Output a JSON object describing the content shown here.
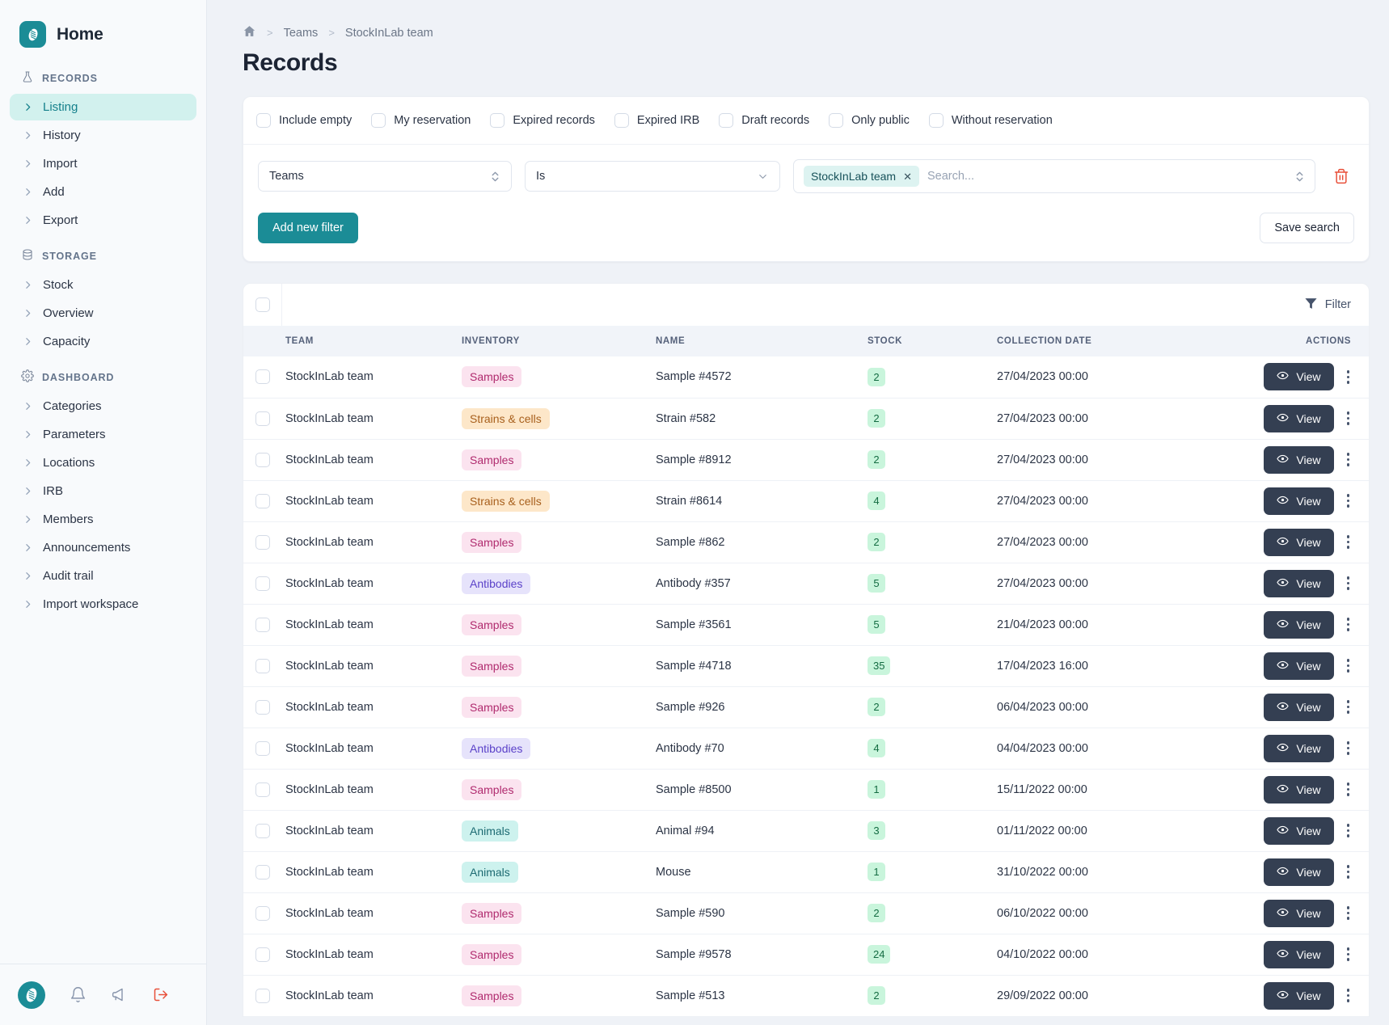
{
  "sidebar": {
    "brand": {
      "title": "Home",
      "logo_icon": "dna-logo-icon"
    },
    "sections": [
      {
        "title": "RECORDS",
        "icon": "flask-icon",
        "items": [
          {
            "label": "Listing",
            "active": true
          },
          {
            "label": "History",
            "active": false
          },
          {
            "label": "Import",
            "active": false
          },
          {
            "label": "Add",
            "active": false
          },
          {
            "label": "Export",
            "active": false
          }
        ]
      },
      {
        "title": "STORAGE",
        "icon": "database-icon",
        "items": [
          {
            "label": "Stock",
            "active": false
          },
          {
            "label": "Overview",
            "active": false
          },
          {
            "label": "Capacity",
            "active": false
          }
        ]
      },
      {
        "title": "DASHBOARD",
        "icon": "gear-icon",
        "items": [
          {
            "label": "Categories",
            "active": false
          },
          {
            "label": "Parameters",
            "active": false
          },
          {
            "label": "Locations",
            "active": false
          },
          {
            "label": "IRB",
            "active": false
          },
          {
            "label": "Members",
            "active": false
          },
          {
            "label": "Announcements",
            "active": false
          },
          {
            "label": "Audit trail",
            "active": false
          },
          {
            "label": "Import workspace",
            "active": false
          }
        ]
      }
    ],
    "footer_icons": [
      {
        "name": "app-logo-icon"
      },
      {
        "name": "bell-icon"
      },
      {
        "name": "megaphone-icon"
      },
      {
        "name": "logout-icon"
      }
    ]
  },
  "breadcrumb": {
    "home_icon": "home-icon",
    "items": [
      "Teams",
      "StockInLab team"
    ],
    "separator": ">"
  },
  "page": {
    "title": "Records"
  },
  "filters": {
    "checkboxes": [
      {
        "label": "Include empty",
        "checked": false
      },
      {
        "label": "My reservation",
        "checked": false
      },
      {
        "label": "Expired records",
        "checked": false
      },
      {
        "label": "Expired IRB",
        "checked": false
      },
      {
        "label": "Draft records",
        "checked": false
      },
      {
        "label": "Only public",
        "checked": false
      },
      {
        "label": "Without reservation",
        "checked": false
      }
    ],
    "field_select": {
      "value": "Teams",
      "icon": "chevron-updown-icon"
    },
    "operator_select": {
      "value": "Is",
      "icon": "chevron-down-icon"
    },
    "value_field": {
      "chips": [
        "StockInLab team"
      ],
      "chip_remove_icon": "close-icon",
      "placeholder": "Search...",
      "icon": "chevron-updown-icon"
    },
    "delete_icon": "trash-icon",
    "add_filter_label": "Add new filter",
    "save_search_label": "Save search"
  },
  "table": {
    "filter_button": {
      "label": "Filter",
      "icon": "funnel-icon"
    },
    "select_all_checkbox": false,
    "columns": [
      "TEAM",
      "INVENTORY",
      "NAME",
      "STOCK",
      "COLLECTION DATE",
      "ACTIONS"
    ],
    "row_action": {
      "label": "View",
      "icon": "eye-icon",
      "menu_icon": "kebab-icon"
    },
    "rows": [
      {
        "team": "StockInLab team",
        "inventory": "Samples",
        "type": "samples",
        "name": "Sample #4572",
        "stock": "2",
        "date": "27/04/2023 00:00"
      },
      {
        "team": "StockInLab team",
        "inventory": "Strains & cells",
        "type": "strains",
        "name": "Strain #582",
        "stock": "2",
        "date": "27/04/2023 00:00"
      },
      {
        "team": "StockInLab team",
        "inventory": "Samples",
        "type": "samples",
        "name": "Sample #8912",
        "stock": "2",
        "date": "27/04/2023 00:00"
      },
      {
        "team": "StockInLab team",
        "inventory": "Strains & cells",
        "type": "strains",
        "name": "Strain #8614",
        "stock": "4",
        "date": "27/04/2023 00:00"
      },
      {
        "team": "StockInLab team",
        "inventory": "Samples",
        "type": "samples",
        "name": "Sample #862",
        "stock": "2",
        "date": "27/04/2023 00:00"
      },
      {
        "team": "StockInLab team",
        "inventory": "Antibodies",
        "type": "antibodies",
        "name": "Antibody #357",
        "stock": "5",
        "date": "27/04/2023 00:00"
      },
      {
        "team": "StockInLab team",
        "inventory": "Samples",
        "type": "samples",
        "name": "Sample #3561",
        "stock": "5",
        "date": "21/04/2023 00:00"
      },
      {
        "team": "StockInLab team",
        "inventory": "Samples",
        "type": "samples",
        "name": "Sample #4718",
        "stock": "35",
        "date": "17/04/2023 16:00"
      },
      {
        "team": "StockInLab team",
        "inventory": "Samples",
        "type": "samples",
        "name": "Sample #926",
        "stock": "2",
        "date": "06/04/2023 00:00"
      },
      {
        "team": "StockInLab team",
        "inventory": "Antibodies",
        "type": "antibodies",
        "name": "Antibody #70",
        "stock": "4",
        "date": "04/04/2023 00:00"
      },
      {
        "team": "StockInLab team",
        "inventory": "Samples",
        "type": "samples",
        "name": "Sample #8500",
        "stock": "1",
        "date": "15/11/2022 00:00"
      },
      {
        "team": "StockInLab team",
        "inventory": "Animals",
        "type": "animals",
        "name": "Animal #94",
        "stock": "3",
        "date": "01/11/2022 00:00"
      },
      {
        "team": "StockInLab team",
        "inventory": "Animals",
        "type": "animals",
        "name": "Mouse",
        "stock": "1",
        "date": "31/10/2022 00:00"
      },
      {
        "team": "StockInLab team",
        "inventory": "Samples",
        "type": "samples",
        "name": "Sample #590",
        "stock": "2",
        "date": "06/10/2022 00:00"
      },
      {
        "team": "StockInLab team",
        "inventory": "Samples",
        "type": "samples",
        "name": "Sample #9578",
        "stock": "24",
        "date": "04/10/2022 00:00"
      },
      {
        "team": "StockInLab team",
        "inventory": "Samples",
        "type": "samples",
        "name": "Sample #513",
        "stock": "2",
        "date": "29/09/2022 00:00"
      }
    ]
  },
  "colors": {
    "brand_teal": "#1b8c96",
    "active_nav_bg": "#d2f1ee",
    "page_bg": "#eff2f7",
    "dark_button": "#343f52",
    "danger_red": "#e8503a",
    "stock_green_bg": "#c9f5dc"
  }
}
